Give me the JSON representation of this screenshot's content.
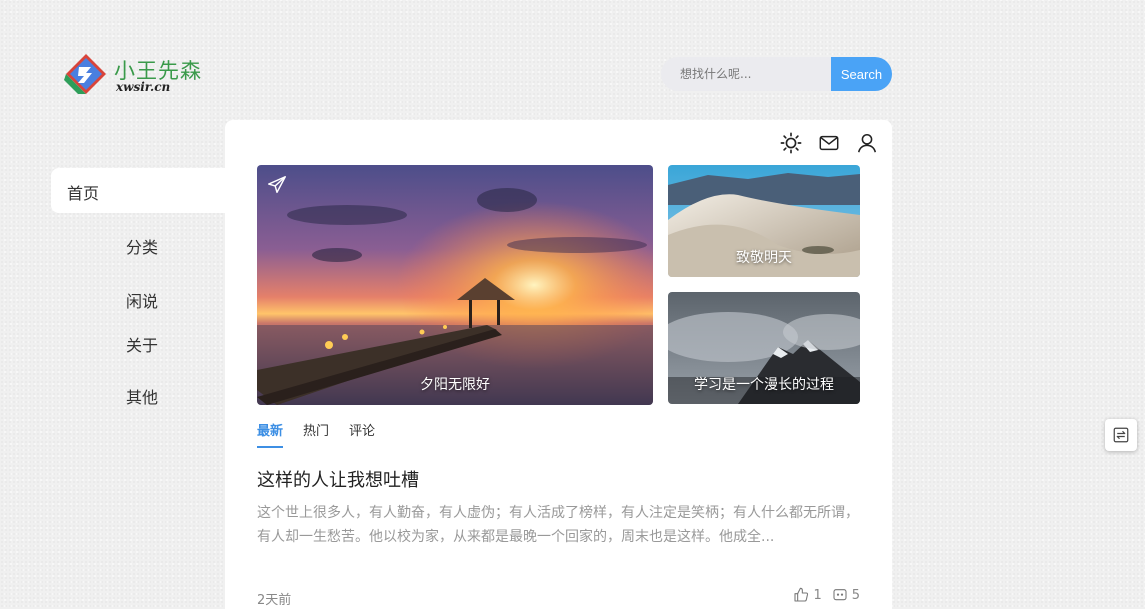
{
  "logo": {
    "title": "小王先森",
    "subtitle": "xwsir.cn"
  },
  "search": {
    "placeholder": "想找什么呢...",
    "button_label": "Search"
  },
  "nav": {
    "items": [
      {
        "label": "首页",
        "active": true
      },
      {
        "label": "分类"
      },
      {
        "label": "闲说"
      },
      {
        "label": "关于"
      },
      {
        "label": "其他"
      }
    ]
  },
  "header_icons": [
    "sun-icon",
    "mail-icon",
    "user-icon"
  ],
  "featured": {
    "main": {
      "caption": "夕阳无限好"
    },
    "side": [
      {
        "caption": "致敬明天"
      },
      {
        "caption": "学习是一个漫长的过程"
      }
    ]
  },
  "tabs": [
    {
      "label": "最新",
      "active": true
    },
    {
      "label": "热门"
    },
    {
      "label": "评论"
    }
  ],
  "post": {
    "title": "这样的人让我想吐槽",
    "excerpt": "这个世上很多人，有人勤奋，有人虚伪；有人活成了榜样，有人注定是笑柄；有人什么都无所谓，有人却一生愁苦。他以校为家，从来都是最晚一个回家的，周末也是这样。他成全...",
    "time": "2天前",
    "likes": "1",
    "comments": "5"
  },
  "colors": {
    "accent": "#4aa3f6",
    "tab_active": "#3d8fe4"
  }
}
